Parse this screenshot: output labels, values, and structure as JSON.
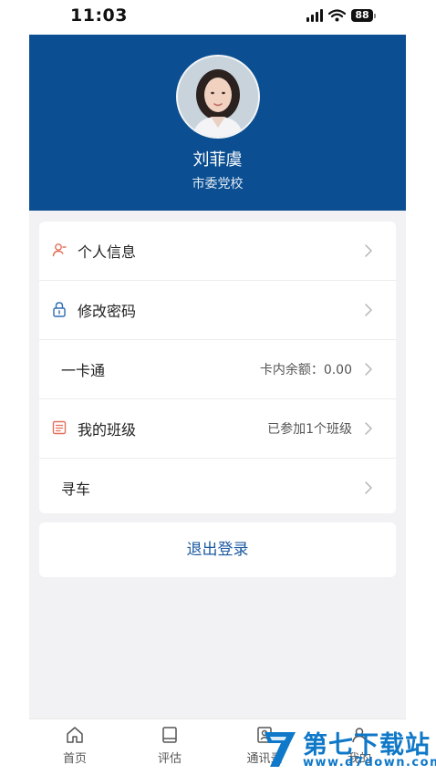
{
  "status": {
    "time": "11:03",
    "battery": "88"
  },
  "profile": {
    "name": "刘菲虞",
    "organization": "市委党校"
  },
  "menu": [
    {
      "label": "个人信息",
      "value": "",
      "icon": "user-icon"
    },
    {
      "label": "修改密码",
      "value": "",
      "icon": "lock-icon"
    },
    {
      "label": "一卡通",
      "value": "卡内余额：0.00",
      "icon": ""
    },
    {
      "label": "我的班级",
      "value": "已参加1个班级",
      "icon": "class-icon"
    },
    {
      "label": "寻车",
      "value": "",
      "icon": ""
    }
  ],
  "logout_label": "退出登录",
  "tabs": [
    {
      "label": "首页",
      "icon": "home-icon"
    },
    {
      "label": "评估",
      "icon": "book-icon"
    },
    {
      "label": "通讯录",
      "icon": "contacts-icon"
    },
    {
      "label": "我的",
      "icon": "profile-icon"
    }
  ],
  "watermark": {
    "title": "第七下载站",
    "url": "www.d7down.com"
  },
  "colors": {
    "header": "#0b4f92",
    "accent": "#1c5aa1",
    "icon": "#e2705a"
  }
}
